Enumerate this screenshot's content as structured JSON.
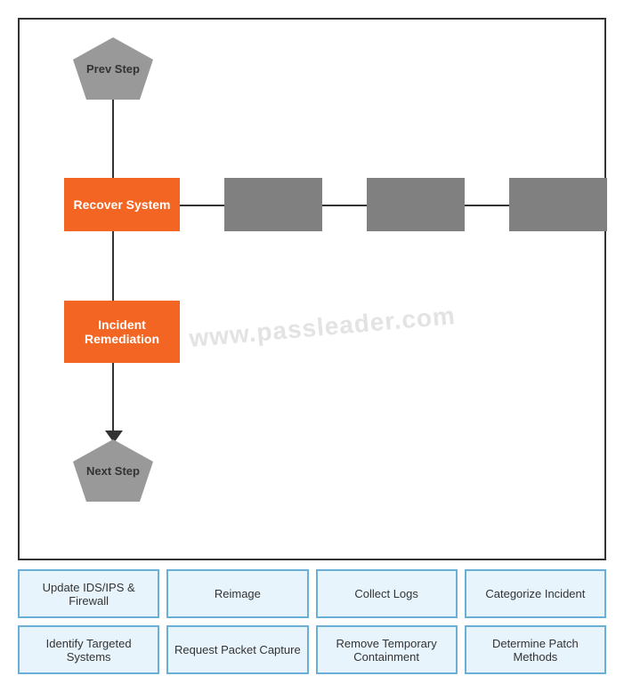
{
  "diagram": {
    "prev_step_label": "Prev Step",
    "next_step_label": "Next Step",
    "recover_system_label": "Recover System",
    "incident_remediation_label": "Incident Remediation",
    "watermark": "www.passleader.com"
  },
  "bottom_grid": {
    "row1": [
      "Update IDS/IPS & Firewall",
      "Reimage",
      "Collect Logs",
      "Categorize Incident"
    ],
    "row2": [
      "Identify Targeted Systems",
      "Request Packet Capture",
      "Remove Temporary Containment",
      "Determine Patch Methods"
    ]
  }
}
